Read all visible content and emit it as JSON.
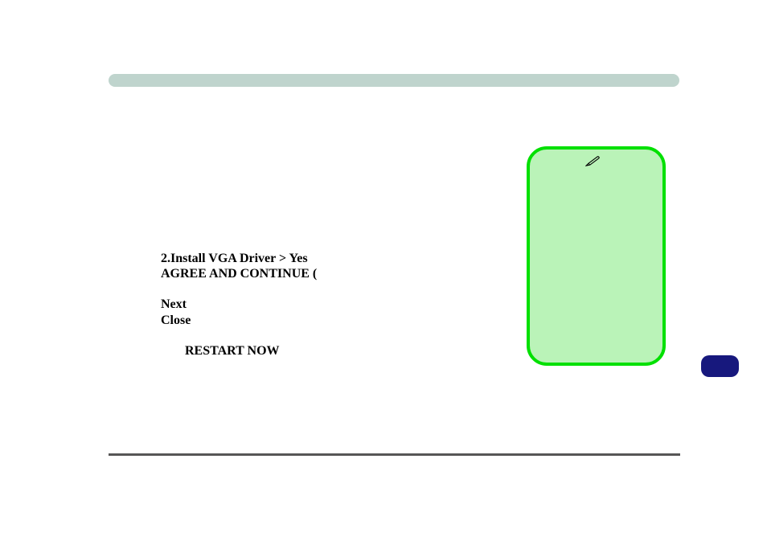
{
  "instructions": {
    "line1": "2.Install VGA Driver > Yes",
    "line2": "AGREE AND CONTINUE (",
    "line3": "Next",
    "line4": "Close",
    "line5": "RESTART NOW"
  }
}
